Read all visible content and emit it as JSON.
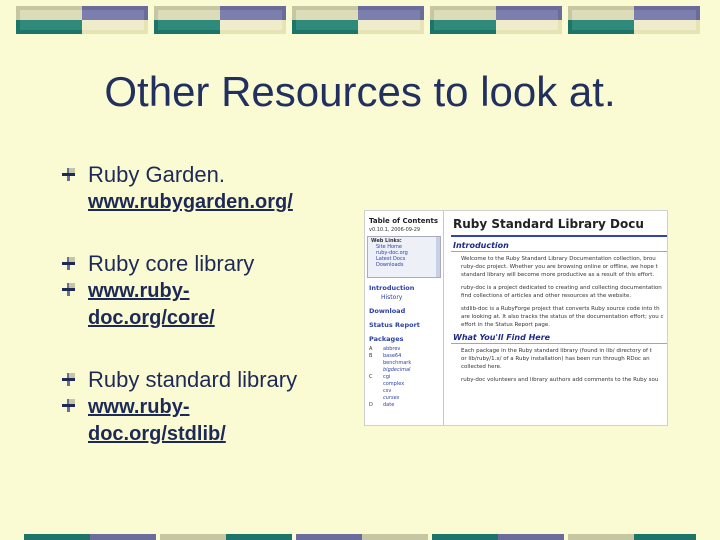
{
  "slide": {
    "title": "Other Resources to look at."
  },
  "bullets": [
    {
      "label": "Ruby Garden.",
      "link": "www.rubygarden.org/"
    },
    {
      "label": "Ruby core library",
      "link_line1": "www.ruby-",
      "link_line2": "doc.org/core/"
    },
    {
      "label": "Ruby standard library",
      "link_line1": "www.ruby-",
      "link_line2": "doc.org/stdlib/"
    }
  ],
  "screenshot": {
    "toc": {
      "title": "Table of Contents",
      "date": "v0.10.1, 2006-09-29",
      "web_links_header": "Web Links:",
      "web_links": [
        "Site Home",
        "ruby-doc.org",
        "Latest Docs",
        "Downloads"
      ],
      "introduction": "Introduction",
      "history": "History",
      "download": "Download",
      "status_report": "Status Report",
      "packages": "Packages",
      "package_list": [
        {
          "letter": "A",
          "name": "abbrev"
        },
        {
          "letter": "B",
          "name": "base64"
        },
        {
          "letter": "",
          "name": "benchmark"
        },
        {
          "letter": "",
          "name": "bigdecimal",
          "italic": true
        },
        {
          "letter": "C",
          "name": "cgi"
        },
        {
          "letter": "",
          "name": "complex"
        },
        {
          "letter": "",
          "name": "csv"
        },
        {
          "letter": "",
          "name": "curses",
          "italic": true
        },
        {
          "letter": "D",
          "name": "date"
        }
      ]
    },
    "main": {
      "title": "Ruby Standard Library Docu",
      "intro_heading": "Introduction",
      "intro_lines": [
        "Welcome to the Ruby Standard Library Documentation collection, brou",
        "ruby-doc project. Whether you are browsing online or offline, we hope t",
        "standard library will become more productive as a result of this effort.",
        "",
        "ruby-doc is a project dedicated to creating and collecting documentation",
        "find collections of articles and other resources at the website.",
        "",
        "stdlib-doc is a RubyForge project that converts Ruby source code into th",
        "are looking at. It also tracks the status of the documentation effort; you c",
        "effort in the Status Report page."
      ],
      "find_heading": "What You'll Find Here",
      "find_lines": [
        "Each package in the Ruby standard library (found in lib/ directory of t",
        "or lib/ruby/1.x/ of a Ruby installation) has been run through RDoc an",
        "collected here.",
        "",
        "ruby-doc volunteers and library authors add comments to the Ruby sou"
      ]
    }
  },
  "colors": {
    "background": "#fbfbd3",
    "title_text": "#22305f",
    "banner_tan": "#c6c7a2",
    "banner_purple": "#6a6d9c",
    "banner_teal": "#1d7468"
  }
}
